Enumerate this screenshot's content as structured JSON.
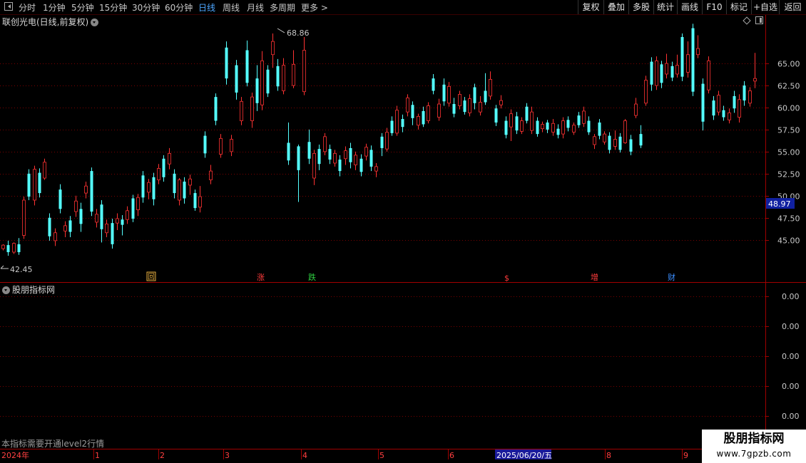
{
  "periods": [
    {
      "label": "分时",
      "active": false
    },
    {
      "label": "1分钟",
      "active": false
    },
    {
      "label": "5分钟",
      "active": false
    },
    {
      "label": "15分钟",
      "active": false
    },
    {
      "label": "30分钟",
      "active": false
    },
    {
      "label": "60分钟",
      "active": false
    },
    {
      "label": "日线",
      "active": true
    },
    {
      "label": "周线",
      "active": false
    },
    {
      "label": "月线",
      "active": false
    },
    {
      "label": "多周期",
      "active": false
    },
    {
      "label": "更多",
      "active": false
    }
  ],
  "toolbar": {
    "fq": "复权",
    "overlay": "叠加",
    "multi": "多股",
    "stats": "统计",
    "draw": "画线",
    "f10": "F10",
    "mark": "标记",
    "watch": "+自选",
    "back": "返回"
  },
  "chart": {
    "title": "联创光电(日线,前复权)",
    "high_label": "68.86",
    "low_label": "42.45",
    "price_badge": "48.97"
  },
  "sub_panel": {
    "title": "股朋指标网",
    "note": "本指标需要开通level2行情",
    "y_labels": [
      "0.00",
      "0.00",
      "0.00",
      "0.00",
      "0.00"
    ]
  },
  "date_axis": [
    {
      "label": "2024年",
      "highlight": false
    },
    {
      "label": "1",
      "highlight": false
    },
    {
      "label": "2",
      "highlight": false
    },
    {
      "label": "3",
      "highlight": false
    },
    {
      "label": "4",
      "highlight": false
    },
    {
      "label": "5",
      "highlight": false
    },
    {
      "label": "6",
      "highlight": false
    },
    {
      "label": "2025/06/20/五",
      "highlight": true
    },
    {
      "label": "8",
      "highlight": false
    },
    {
      "label": "9",
      "highlight": false
    }
  ],
  "markers": [
    {
      "label": "回",
      "color": "#e8b040"
    },
    {
      "label": "涨",
      "color": "#ff3b3b"
    },
    {
      "label": "跌",
      "color": "#2ecc40"
    },
    {
      "label": "$",
      "color": "#ff3b3b"
    },
    {
      "label": "增",
      "color": "#ff3b3b"
    },
    {
      "label": "财",
      "color": "#3b8eff"
    }
  ],
  "watermark": {
    "line1": "股朋指标网",
    "line2": "www.7gpzb.com"
  },
  "colors": {
    "up": "#ff3232",
    "down": "#54ffff",
    "grid": "#7a0000",
    "axis": "#a00000",
    "active": "#4da6ff"
  },
  "chart_data": {
    "type": "candlestick",
    "title": "联创光电(日线,前复权)",
    "y_ticks": [
      45.0,
      47.5,
      50.0,
      52.5,
      55.0,
      57.5,
      60.0,
      62.5,
      65.0
    ],
    "ylim": [
      41.5,
      70.5
    ],
    "marked_high": 68.86,
    "marked_low": 42.45,
    "last_price_badge": 48.97,
    "series": [
      {
        "name": "up",
        "values": [
          [
            44.0,
            44.4,
            43.8,
            44.5
          ],
          [
            43.6,
            44.6,
            43.4,
            44.7
          ],
          [
            45.5,
            49.5,
            45.1,
            49.9
          ],
          [
            49.5,
            53.0,
            48.9,
            53.4
          ],
          [
            52.0,
            53.8,
            51.8,
            54.2
          ],
          [
            44.9,
            45.8,
            44.3,
            46.3
          ],
          [
            46.0,
            46.6,
            45.3,
            47.1
          ],
          [
            48.2,
            49.4,
            47.6,
            50.0
          ],
          [
            50.3,
            51.1,
            49.7,
            51.6
          ],
          [
            47.0,
            47.9,
            46.4,
            48.5
          ],
          [
            45.8,
            46.8,
            45.3,
            47.3
          ],
          [
            46.9,
            47.4,
            46.1,
            48.0
          ],
          [
            47.3,
            48.3,
            46.8,
            48.8
          ],
          [
            48.4,
            49.8,
            47.7,
            50.2
          ],
          [
            50.4,
            51.5,
            49.6,
            51.9
          ],
          [
            51.8,
            53.1,
            51.3,
            53.6
          ],
          [
            53.6,
            54.8,
            53.0,
            55.4
          ],
          [
            49.5,
            51.8,
            48.9,
            52.0
          ],
          [
            51.2,
            51.9,
            50.1,
            52.4
          ],
          [
            48.7,
            49.9,
            48.1,
            51.1
          ],
          [
            51.8,
            52.8,
            51.3,
            53.5
          ],
          [
            54.7,
            56.5,
            54.3,
            57.0
          ],
          [
            55.0,
            56.4,
            54.5,
            56.9
          ],
          [
            58.5,
            60.7,
            58.0,
            61.2
          ],
          [
            58.5,
            61.2,
            57.7,
            61.7
          ],
          [
            60.3,
            65.3,
            59.7,
            66.4
          ],
          [
            66.0,
            67.5,
            64.5,
            68.4
          ],
          [
            61.9,
            64.8,
            61.5,
            65.6
          ],
          [
            62.5,
            64.9,
            62.2,
            66.5
          ],
          [
            61.8,
            66.5,
            61.4,
            68.0
          ],
          [
            52.0,
            54.8,
            51.2,
            55.2
          ],
          [
            55.0,
            56.7,
            54.6,
            57.1
          ],
          [
            53.7,
            54.8,
            53.3,
            55.2
          ],
          [
            54.2,
            55.1,
            53.5,
            55.6
          ],
          [
            53.5,
            54.6,
            52.9,
            55.0
          ],
          [
            54.5,
            55.5,
            54.0,
            55.9
          ],
          [
            52.8,
            53.3,
            52.1,
            53.7
          ],
          [
            55.3,
            57.2,
            55.0,
            57.7
          ],
          [
            57.1,
            59.7,
            56.8,
            60.2
          ],
          [
            59.5,
            61.1,
            59.0,
            61.5
          ],
          [
            58.0,
            59.0,
            57.5,
            59.3
          ],
          [
            58.5,
            60.2,
            58.2,
            60.6
          ],
          [
            58.9,
            60.4,
            58.5,
            61.0
          ],
          [
            60.5,
            62.4,
            60.1,
            62.9
          ],
          [
            60.2,
            61.5,
            59.8,
            61.9
          ],
          [
            59.4,
            61.0,
            59.0,
            61.5
          ],
          [
            59.5,
            60.6,
            59.1,
            61.3
          ],
          [
            61.3,
            63.2,
            60.9,
            64.1
          ],
          [
            60.3,
            60.8,
            59.9,
            61.4
          ],
          [
            57.8,
            59.3,
            56.2,
            59.8
          ],
          [
            57.3,
            58.5,
            57.0,
            58.9
          ],
          [
            57.4,
            59.5,
            57.0,
            60.1
          ],
          [
            57.6,
            58.1,
            57.2,
            58.4
          ],
          [
            57.2,
            58.2,
            56.8,
            58.7
          ],
          [
            57.0,
            58.5,
            56.5,
            58.9
          ],
          [
            57.2,
            58.0,
            56.9,
            58.3
          ],
          [
            58.2,
            59.6,
            57.8,
            60.1
          ],
          [
            55.8,
            56.7,
            55.3,
            57.0
          ],
          [
            56.1,
            57.0,
            55.8,
            57.3
          ],
          [
            55.6,
            56.4,
            55.2,
            57.4
          ],
          [
            56.0,
            58.5,
            55.9,
            58.7
          ],
          [
            59.1,
            60.4,
            58.8,
            61.1
          ],
          [
            60.5,
            63.1,
            60.2,
            63.6
          ],
          [
            62.5,
            65.3,
            62.0,
            65.8
          ],
          [
            63.8,
            65.0,
            63.3,
            66.1
          ],
          [
            63.8,
            64.8,
            63.4,
            66.0
          ],
          [
            64.0,
            66.0,
            63.4,
            67.5
          ],
          [
            66.0,
            66.7,
            65.6,
            68.2
          ],
          [
            62.0,
            65.3,
            61.6,
            65.8
          ],
          [
            59.5,
            61.4,
            59.1,
            61.9
          ],
          [
            58.6,
            59.4,
            58.2,
            59.9
          ],
          [
            58.9,
            60.9,
            58.3,
            61.5
          ],
          [
            60.5,
            61.9,
            60.1,
            62.3
          ],
          [
            63.0,
            63.3,
            62.2,
            66.2
          ]
        ]
      },
      {
        "name": "down",
        "values": [
          [
            44.4,
            43.6,
            43.2,
            44.9
          ],
          [
            44.5,
            43.6,
            43.3,
            45.2
          ],
          [
            52.5,
            49.9,
            49.5,
            53.0
          ],
          [
            52.6,
            50.3,
            49.8,
            53.1
          ],
          [
            47.5,
            45.4,
            44.9,
            48.0
          ],
          [
            50.7,
            48.5,
            48.0,
            51.3
          ],
          [
            47.2,
            45.9,
            45.3,
            47.7
          ],
          [
            48.5,
            46.8,
            45.9,
            49.2
          ],
          [
            52.8,
            48.2,
            47.7,
            53.2
          ],
          [
            49.0,
            46.2,
            44.7,
            49.5
          ],
          [
            46.9,
            44.5,
            44.0,
            47.4
          ],
          [
            47.3,
            46.7,
            45.5,
            47.8
          ],
          [
            49.7,
            47.4,
            47.0,
            50.1
          ],
          [
            52.3,
            49.8,
            49.2,
            52.8
          ],
          [
            52.1,
            49.6,
            48.9,
            52.6
          ],
          [
            54.2,
            52.1,
            51.6,
            54.6
          ],
          [
            52.5,
            50.3,
            49.7,
            53.0
          ],
          [
            51.6,
            49.7,
            49.1,
            52.1
          ],
          [
            50.3,
            48.6,
            48.3,
            50.7
          ],
          [
            56.8,
            54.8,
            54.3,
            57.3
          ],
          [
            61.2,
            58.5,
            58.0,
            61.6
          ],
          [
            66.8,
            63.3,
            62.6,
            67.5
          ],
          [
            64.8,
            61.7,
            60.9,
            65.4
          ],
          [
            66.5,
            62.8,
            62.4,
            67.6
          ],
          [
            63.3,
            60.5,
            59.6,
            64.8
          ],
          [
            64.3,
            61.6,
            61.2,
            64.8
          ],
          [
            64.7,
            62.4,
            61.9,
            65.5
          ],
          [
            56.0,
            54.0,
            53.5,
            58.3
          ],
          [
            55.6,
            52.9,
            49.3,
            55.8
          ],
          [
            56.1,
            54.2,
            53.6,
            57.5
          ],
          [
            55.3,
            53.6,
            52.9,
            55.8
          ],
          [
            55.3,
            54.1,
            53.6,
            55.8
          ],
          [
            54.1,
            52.8,
            52.2,
            54.6
          ],
          [
            55.4,
            53.8,
            53.1,
            56.0
          ],
          [
            54.2,
            52.7,
            52.2,
            54.7
          ],
          [
            55.2,
            53.3,
            52.8,
            55.7
          ],
          [
            56.7,
            55.4,
            54.5,
            57.1
          ],
          [
            58.5,
            57.1,
            56.8,
            59.0
          ],
          [
            58.7,
            57.8,
            57.2,
            59.2
          ],
          [
            60.3,
            58.8,
            58.0,
            60.7
          ],
          [
            59.6,
            58.1,
            57.8,
            60.1
          ],
          [
            63.3,
            61.9,
            61.5,
            63.8
          ],
          [
            62.6,
            60.7,
            60.2,
            63.3
          ],
          [
            60.4,
            59.3,
            58.9,
            61.1
          ],
          [
            60.8,
            59.5,
            59.2,
            61.2
          ],
          [
            62.3,
            60.5,
            59.8,
            62.7
          ],
          [
            61.9,
            60.6,
            60.3,
            63.9
          ],
          [
            59.9,
            58.3,
            57.9,
            60.3
          ],
          [
            58.5,
            56.9,
            56.5,
            59.0
          ],
          [
            59.0,
            57.4,
            57.0,
            59.5
          ],
          [
            60.1,
            58.5,
            58.2,
            60.5
          ],
          [
            58.5,
            57.0,
            56.7,
            58.9
          ],
          [
            58.3,
            57.5,
            57.1,
            58.6
          ],
          [
            57.6,
            56.9,
            56.5,
            58.1
          ],
          [
            58.6,
            57.7,
            57.3,
            59.0
          ],
          [
            59.1,
            58.0,
            57.7,
            59.5
          ],
          [
            58.5,
            57.2,
            56.9,
            59.0
          ],
          [
            58.3,
            56.8,
            56.4,
            58.7
          ],
          [
            56.8,
            55.2,
            54.8,
            57.2
          ],
          [
            56.7,
            55.2,
            54.9,
            57.1
          ],
          [
            56.4,
            55.0,
            54.6,
            56.9
          ],
          [
            57.0,
            55.7,
            55.4,
            58.0
          ],
          [
            65.2,
            62.6,
            61.9,
            65.7
          ],
          [
            64.9,
            62.8,
            62.2,
            65.3
          ],
          [
            64.7,
            63.4,
            63.0,
            65.2
          ],
          [
            68.0,
            63.5,
            63.0,
            68.4
          ],
          [
            69.0,
            61.8,
            61.3,
            69.5
          ],
          [
            62.7,
            58.4,
            57.4,
            63.3
          ],
          [
            60.8,
            59.1,
            58.6,
            61.3
          ],
          [
            59.7,
            58.9,
            58.5,
            60.2
          ],
          [
            61.3,
            59.9,
            59.4,
            61.9
          ],
          [
            62.5,
            60.8,
            60.2,
            63.0
          ]
        ]
      }
    ]
  }
}
